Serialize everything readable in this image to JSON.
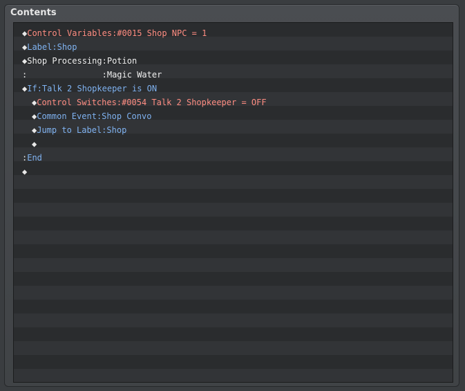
{
  "panel": {
    "title": "Contents"
  },
  "rows": [
    {
      "indent": 0,
      "marker": "◆",
      "cmd": "Control Variables",
      "sep": ":",
      "arg": "#0015 Shop NPC = 1",
      "color": "red"
    },
    {
      "indent": 0,
      "marker": "◆",
      "cmd": "Label",
      "sep": ":",
      "arg": "Shop",
      "color": "blue"
    },
    {
      "indent": 0,
      "marker": "◆",
      "cmd": "Shop Processing",
      "sep": ":",
      "arg": "Potion",
      "color": "white"
    },
    {
      "indent": 0,
      "marker": ":",
      "cmd": "               ",
      "sep": ":",
      "arg": "Magic Water",
      "color": "white"
    },
    {
      "indent": 0,
      "marker": "◆",
      "cmd": "If",
      "sep": ":",
      "arg": "Talk 2 Shopkeeper is ON",
      "color": "blue"
    },
    {
      "indent": 1,
      "marker": "◆",
      "cmd": "Control Switches",
      "sep": ":",
      "arg": "#0054 Talk 2 Shopkeeper = OFF",
      "color": "red"
    },
    {
      "indent": 1,
      "marker": "◆",
      "cmd": "Common Event",
      "sep": ":",
      "arg": "Shop Convo",
      "color": "blue"
    },
    {
      "indent": 1,
      "marker": "◆",
      "cmd": "Jump to Label",
      "sep": ":",
      "arg": "Shop",
      "color": "blue"
    },
    {
      "indent": 1,
      "marker": "◆",
      "cmd": "",
      "sep": "",
      "arg": "",
      "color": "white"
    },
    {
      "indent": 0,
      "marker": ":",
      "cmd": "End",
      "sep": "",
      "arg": "",
      "color": "blue"
    },
    {
      "indent": 0,
      "marker": "◆",
      "cmd": "",
      "sep": "",
      "arg": "",
      "color": "white"
    }
  ],
  "colors": {
    "red": "#ff8d82",
    "blue": "#7fb2f0",
    "white": "#eeeeee"
  }
}
